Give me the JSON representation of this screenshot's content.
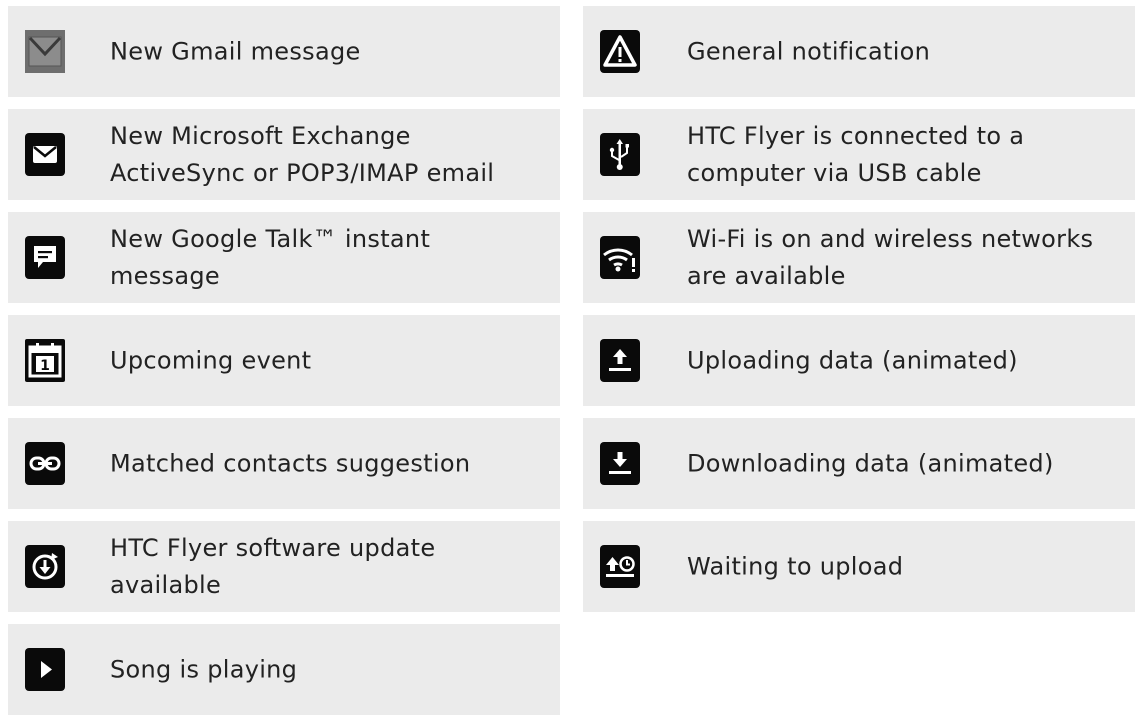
{
  "left_items": [
    {
      "icon": "gmail-icon",
      "text": "New Gmail message"
    },
    {
      "icon": "email-icon",
      "text": "New Microsoft Exchange ActiveSync or POP3/IMAP email"
    },
    {
      "icon": "chat-icon",
      "text": "New Google Talk™ instant message"
    },
    {
      "icon": "calendar-icon",
      "text": "Upcoming event"
    },
    {
      "icon": "link-icon",
      "text": "Matched contacts suggestion"
    },
    {
      "icon": "software-update-icon",
      "text": "HTC Flyer software update available"
    },
    {
      "icon": "play-icon",
      "text": "Song is playing"
    }
  ],
  "right_items": [
    {
      "icon": "warning-icon",
      "text": "General notification"
    },
    {
      "icon": "usb-icon",
      "text": "HTC Flyer is connected to a computer via USB cable"
    },
    {
      "icon": "wifi-alert-icon",
      "text": "Wi-Fi is on and wireless networks are available"
    },
    {
      "icon": "upload-icon",
      "text": "Uploading data (animated)"
    },
    {
      "icon": "download-icon",
      "text": "Downloading data (animated)"
    },
    {
      "icon": "waiting-upload-icon",
      "text": "Waiting to upload"
    }
  ]
}
